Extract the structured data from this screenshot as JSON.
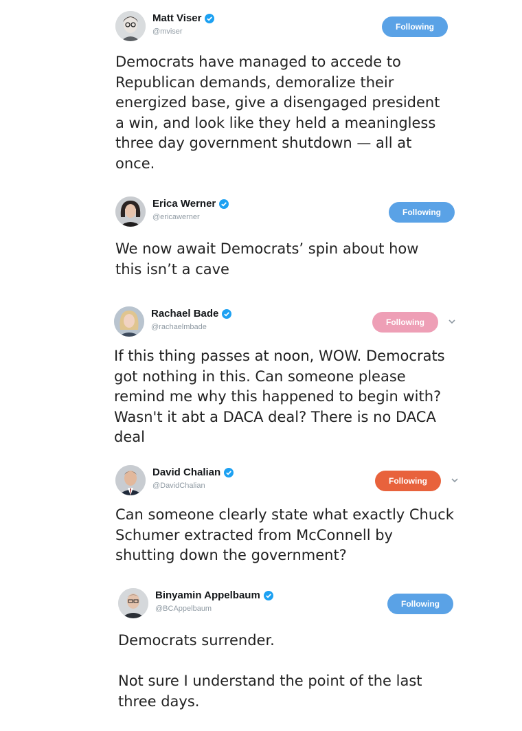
{
  "tweets": [
    {
      "name": "Matt Viser",
      "handle": "@mviser",
      "follow_label": "Following",
      "follow_color": "#5aa2e6",
      "has_chevron": false,
      "avatar_icon": "avatar-matt-viser",
      "text": "Democrats have managed to accede to\nRepublican demands, demoralize their\nenergized base, give a disengaged president\na win, and look like they held a meaningless\nthree day government shutdown — all at\nonce."
    },
    {
      "name": "Erica Werner",
      "handle": "@ericawerner",
      "follow_label": "Following",
      "follow_color": "#5aa2e6",
      "has_chevron": false,
      "avatar_icon": "avatar-erica-werner",
      "text": "We now await Democrats’ spin about how\nthis isn’t a cave"
    },
    {
      "name": "Rachael Bade",
      "handle": "@rachaelmbade",
      "follow_label": "Following",
      "follow_color": "#ee9fb6",
      "has_chevron": true,
      "avatar_icon": "avatar-rachael-bade",
      "text": "If this thing passes at noon, WOW. Democrats\ngot nothing in this. Can someone please\nremind me why this happened to begin with?\nWasn't it abt a DACA deal? There is no DACA\ndeal"
    },
    {
      "name": "David Chalian",
      "handle": "@DavidChalian",
      "follow_label": "Following",
      "follow_color": "#e8623c",
      "has_chevron": true,
      "avatar_icon": "avatar-david-chalian",
      "text": "Can someone clearly state what exactly Chuck\nSchumer extracted from McConnell by\nshutting down the government?"
    },
    {
      "name": "Binyamin Appelbaum",
      "handle": "@BCAppelbaum",
      "follow_label": "Following",
      "follow_color": "#5aa2e6",
      "has_chevron": false,
      "avatar_icon": "avatar-binyamin-appelbaum",
      "text": "Democrats surrender.\n\nNot sure I understand the point of the last\nthree days."
    }
  ],
  "icons": {
    "verified": "verified-badge-icon",
    "chevron": "chevron-down-icon"
  },
  "colors": {
    "verified_blue": "#1da1f2",
    "text": "#222222",
    "handle": "#8f9aa3"
  }
}
